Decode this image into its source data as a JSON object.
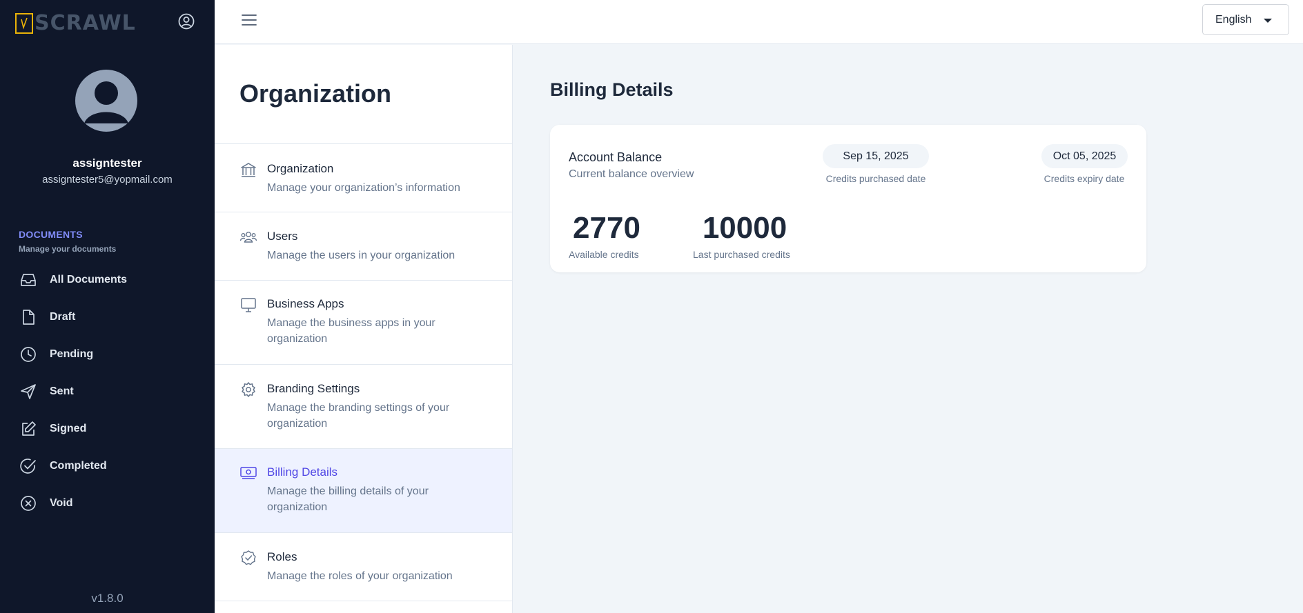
{
  "app": {
    "logo_text": "SCRAWL",
    "version": "v1.8.0"
  },
  "user": {
    "name": "assigntester",
    "email": "assigntester5@yopmail.com"
  },
  "sidebar": {
    "section_title": "DOCUMENTS",
    "section_subtitle": "Manage your documents",
    "items": [
      {
        "label": "All Documents",
        "icon": "inbox-icon"
      },
      {
        "label": "Draft",
        "icon": "file-icon"
      },
      {
        "label": "Pending",
        "icon": "clock-icon"
      },
      {
        "label": "Sent",
        "icon": "send-icon"
      },
      {
        "label": "Signed",
        "icon": "edit-icon"
      },
      {
        "label": "Completed",
        "icon": "check-circle-icon"
      },
      {
        "label": "Void",
        "icon": "x-circle-icon"
      }
    ]
  },
  "topbar": {
    "language": "English"
  },
  "settings": {
    "title": "Organization",
    "items": [
      {
        "title": "Organization",
        "desc": "Manage your organization’s information",
        "icon": "bank-icon",
        "active": false
      },
      {
        "title": "Users",
        "desc": "Manage the users in your organization",
        "icon": "users-icon",
        "active": false
      },
      {
        "title": "Business Apps",
        "desc": "Manage the business apps in your organization",
        "icon": "monitor-icon",
        "active": false
      },
      {
        "title": "Branding Settings",
        "desc": "Manage the branding settings of your organization",
        "icon": "gear-icon",
        "active": false
      },
      {
        "title": "Billing Details",
        "desc": "Manage the billing details of your organization",
        "icon": "money-icon",
        "active": true
      },
      {
        "title": "Roles",
        "desc": "Manage the roles of your organization",
        "icon": "badge-check-icon",
        "active": false
      }
    ]
  },
  "billing": {
    "title": "Billing Details",
    "account_title": "Account Balance",
    "account_subtitle": "Current balance overview",
    "purchased_date": "Sep 15, 2025",
    "purchased_date_label": "Credits purchased date",
    "expiry_date": "Oct 05, 2025",
    "expiry_date_label": "Credits expiry date",
    "available_credits": "2770",
    "available_credits_label": "Available credits",
    "last_purchased_credits": "10000",
    "last_purchased_credits_label": "Last purchased credits"
  },
  "colors": {
    "sidebar_bg": "#0f172a",
    "accent": "#4f46e5",
    "logo_accent": "#eab308"
  }
}
